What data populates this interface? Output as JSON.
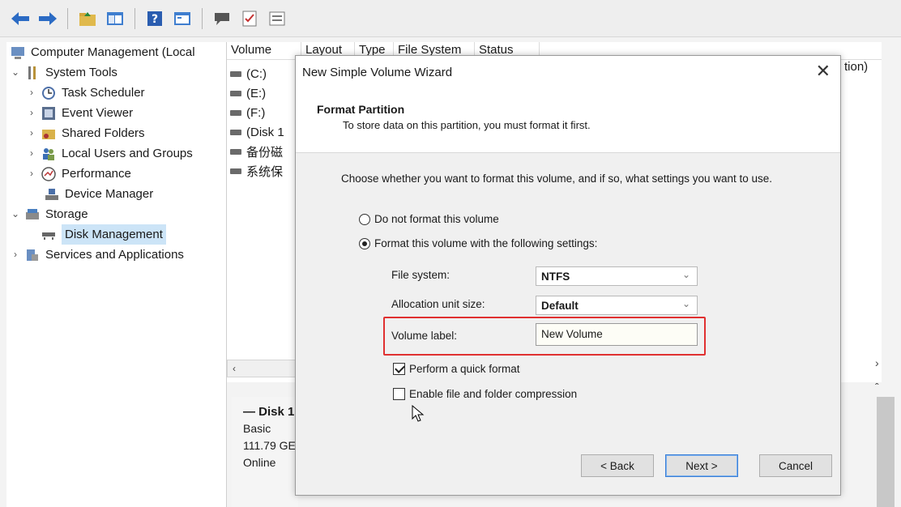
{
  "colors": {
    "highlight": "#e03030",
    "selection": "#cce4f7",
    "primary_button_border": "#3c7fd6"
  },
  "toolbar": {
    "icons": [
      "back-icon",
      "forward-icon",
      "up-folder-icon",
      "console-tree-icon",
      "help-icon",
      "properties-icon",
      "message-icon",
      "checklist-icon",
      "list-view-icon"
    ]
  },
  "tree": {
    "root": "Computer Management (Local",
    "system_tools": "System Tools",
    "task_scheduler": "Task Scheduler",
    "event_viewer": "Event Viewer",
    "shared_folders": "Shared Folders",
    "local_users": "Local Users and Groups",
    "performance": "Performance",
    "device_manager": "Device Manager",
    "storage": "Storage",
    "disk_management": "Disk Management",
    "services": "Services and Applications"
  },
  "volumes": {
    "headers": [
      "Volume",
      "Layout",
      "Type",
      "File System",
      "Status"
    ],
    "rows": [
      "(C:)",
      "(E:)",
      "(F:)",
      "(Disk 1",
      "备份磁",
      "系统保"
    ],
    "right_col_tail": "tion)"
  },
  "disk_info": {
    "name": "Disk 1",
    "type": "Basic",
    "size": "111.79 GE",
    "status": "Online"
  },
  "dialog": {
    "title": "New Simple Volume Wizard",
    "header_title": "Format Partition",
    "header_subtitle": "To store data on this partition, you must format it first.",
    "instruction": "Choose whether you want to format this volume, and if so, what settings you want to use.",
    "radio_no_format": "Do not format this volume",
    "radio_format": "Format this volume with the following settings:",
    "file_system_label": "File system:",
    "file_system_value": "NTFS",
    "alloc_label": "Allocation unit size:",
    "alloc_value": "Default",
    "volume_label_label": "Volume label:",
    "volume_label_value": "New Volume",
    "quick_format": "Perform a quick format",
    "compression": "Enable file and folder compression",
    "back": "< Back",
    "next": "Next >",
    "cancel": "Cancel"
  }
}
